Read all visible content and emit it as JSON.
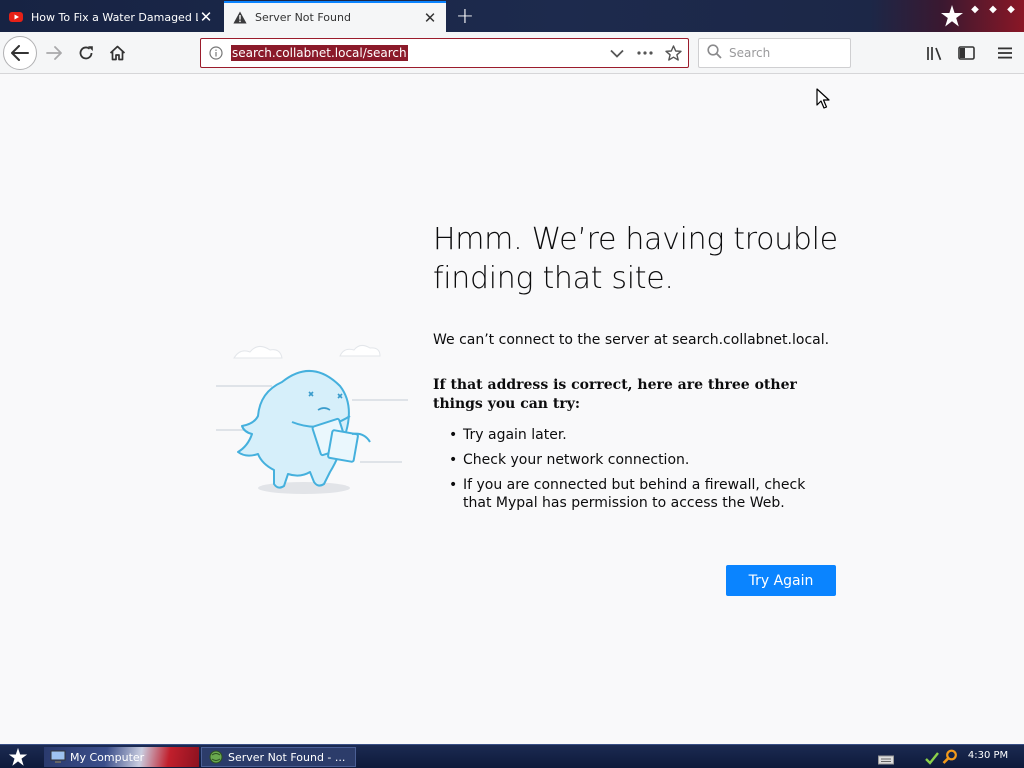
{
  "window": {
    "tabs": [
      {
        "title": "How To Fix a Water Damaged Laptop",
        "favicon": "youtube-icon",
        "active": false
      },
      {
        "title": "Server Not Found",
        "favicon": "warning-icon",
        "active": true
      }
    ]
  },
  "navbar": {
    "url": "search.collabnet.local/search",
    "search_placeholder": "Search"
  },
  "error_page": {
    "title": "Hmm. We’re having trouble finding that site.",
    "description": "We can’t connect to the server at search.collabnet.local.",
    "subheading": "If that address is correct, here are three other things you can try:",
    "suggestions": [
      "Try again later.",
      "Check your network connection.",
      "If you are connected but behind a firewall, check that Mypal has permission to access the Web."
    ],
    "try_again_label": "Try Again"
  },
  "taskbar": {
    "items": [
      {
        "label": "My Computer",
        "icon": "computer-icon"
      },
      {
        "label": "Server Not Found - ...",
        "icon": "browser-icon"
      }
    ],
    "clock": "4:30 PM"
  },
  "colors": {
    "accent": "#0a84ff",
    "url_highlight": "#8b1a2a",
    "tabstrip": "#1d2a4d",
    "illustration": "#5ab8e0"
  }
}
